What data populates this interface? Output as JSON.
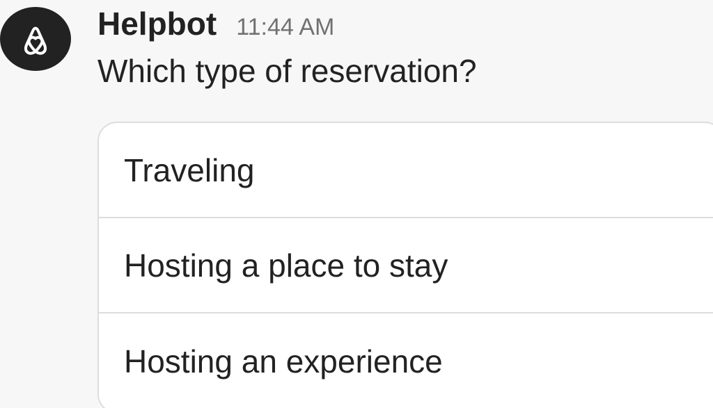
{
  "message": {
    "sender": "Helpbot",
    "timestamp": "11:44 AM",
    "text": "Which type of reservation?",
    "avatar_icon": "airbnb-logo-icon"
  },
  "options": [
    {
      "label": "Traveling"
    },
    {
      "label": "Hosting a place to stay"
    },
    {
      "label": "Hosting an experience"
    }
  ],
  "colors": {
    "avatar_bg": "#222222",
    "text": "#222222",
    "timestamp": "#717171",
    "border": "#dddddd"
  }
}
